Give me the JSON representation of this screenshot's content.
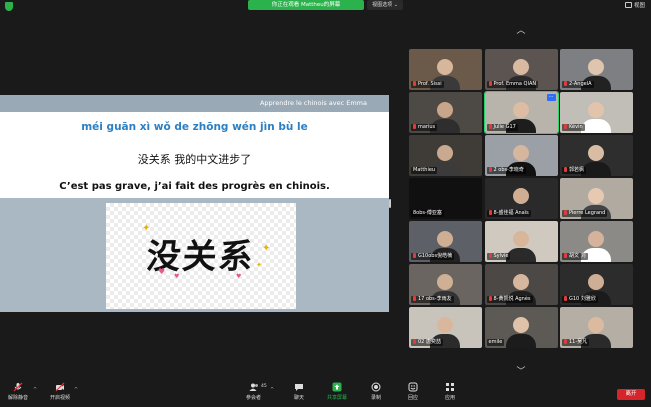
{
  "topbar": {
    "share_status": "你正在观看 Mattheu的屏幕",
    "view_options": "视图选项 ⌄",
    "view_label": "视图"
  },
  "slide": {
    "header": "Apprendre le chinois avec Emma",
    "pinyin": "méi guān xì wǒ de zhōng wén jìn bù le",
    "hanzi": "没关系 我的中文进步了",
    "french": "C’est pas grave, j’ai fait des progrès en chinois.",
    "image_text": "没关系"
  },
  "gallery": {
    "up_arrow": "︿",
    "down_arrow": "﹀",
    "participants": [
      {
        "name": "Prof. Sissi",
        "muted": true,
        "bg": "#6b5a4a",
        "skin": "#d7b79b",
        "shirt": "#3a3a3a"
      },
      {
        "name": "Prof. Emma QIAN",
        "muted": true,
        "bg": "#5b5450",
        "skin": "#d9b9a0",
        "shirt": "#2a2a2a"
      },
      {
        "name": "2-AngelA",
        "muted": true,
        "bg": "#7d7f82",
        "skin": "#e0c5ae",
        "shirt": "#222"
      },
      {
        "name": "marius",
        "muted": true,
        "bg": "#4d4a45",
        "skin": "#c9a58a",
        "shirt": "#2e2e2e"
      },
      {
        "name": "Julie G17",
        "muted": true,
        "bg": "#b8b3ab",
        "skin": "#dcbda3",
        "shirt": "#1d1d1d",
        "active": true
      },
      {
        "name": "Kévin",
        "muted": true,
        "bg": "#c1beb8",
        "skin": "#e2c4ac",
        "shirt": "#ffffff"
      },
      {
        "name": "Matthieu",
        "muted": false,
        "bg": "#3f3c38",
        "skin": "#c9aa90",
        "shirt": "#3b3b3b"
      },
      {
        "name": "2 obs-李晓奇",
        "muted": true,
        "bg": "#9aa0a6",
        "skin": "#d6b69d",
        "shirt": "#111"
      },
      {
        "name": "郭若枫",
        "muted": true,
        "bg": "#2e2e2e",
        "skin": "#d9bca4",
        "shirt": "#1a1a1a"
      },
      {
        "name": "8obs-傅亚塞",
        "muted": false,
        "bg": "#101010",
        "skin": "#101010",
        "shirt": "#101010"
      },
      {
        "name": "8-盛佳福 Anaïs",
        "muted": true,
        "bg": "#2a2a2a",
        "skin": "#cfae94",
        "shirt": "#2b2b2b"
      },
      {
        "name": "Pierre Legrand",
        "muted": true,
        "bg": "#b0aaa1",
        "skin": "#e6c9b0",
        "shirt": "#444"
      },
      {
        "name": "G10obs倪皓楠",
        "muted": true,
        "bg": "#5d6066",
        "skin": "#cfae94",
        "shirt": "#222"
      },
      {
        "name": "Sylvie",
        "muted": true,
        "bg": "#cfc9c0",
        "skin": "#d8b69a",
        "shirt": "#2a2a2a"
      },
      {
        "name": "胡文 刘",
        "muted": true,
        "bg": "#8c8a86",
        "skin": "#d4b39a",
        "shirt": "#ffffff"
      },
      {
        "name": "17 obs-李雨友",
        "muted": true,
        "bg": "#6a6560",
        "skin": "#cfb095",
        "shirt": "#333"
      },
      {
        "name": "8-黄凯悦 Agnès",
        "muted": true,
        "bg": "#4b4845",
        "skin": "#d6b69c",
        "shirt": "#1f1f1f"
      },
      {
        "name": "G10 刘雅欣",
        "muted": true,
        "bg": "#2c2c2c",
        "skin": "#ceae95",
        "shirt": "#1b1b1b"
      },
      {
        "name": "02 唐奕喆",
        "muted": true,
        "bg": "#c9c4bb",
        "skin": "#d8b79d",
        "shirt": "#2b2b2b"
      },
      {
        "name": "emile",
        "muted": false,
        "bg": "#5d5a55",
        "skin": "#e0c2a8",
        "shirt": "#1c1c1c"
      },
      {
        "name": "11-吴凡",
        "muted": true,
        "bg": "#b5aea5",
        "skin": "#dbbaa0",
        "shirt": "#2a2a2a"
      }
    ]
  },
  "toolbar": {
    "unmute": "解除静音",
    "start_video": "开启视频",
    "participants": "参会者",
    "participants_count": "45",
    "chat": "聊天",
    "share_screen": "共享屏幕",
    "record": "录制",
    "reactions": "回应",
    "apps": "应用",
    "leave": "离开"
  },
  "colors": {
    "accent_green": "#2bb24c",
    "leave_red": "#d5252b",
    "pinyin_blue": "#2c7fc3",
    "slide_bg": "#a9b8c3"
  }
}
